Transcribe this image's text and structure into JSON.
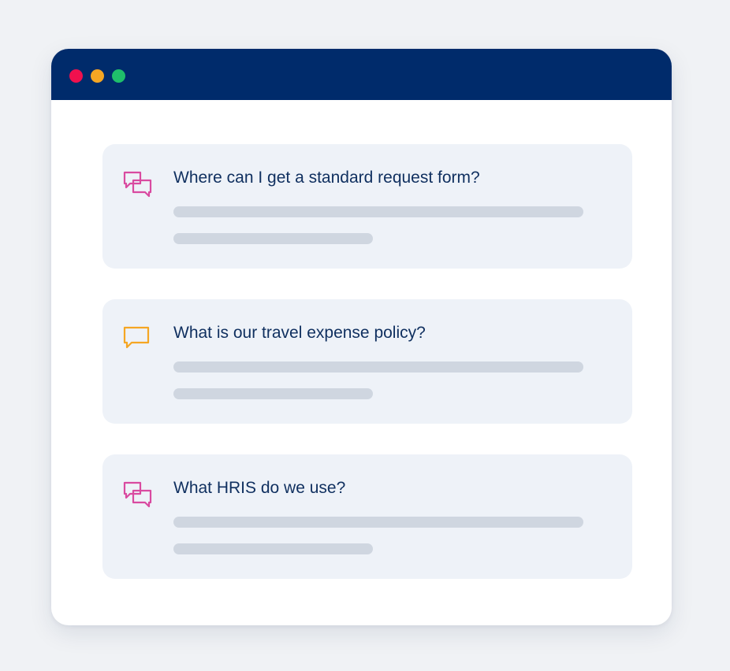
{
  "window": {
    "controls": [
      {
        "name": "close",
        "color": "#f0114e"
      },
      {
        "name": "minimize",
        "color": "#f5a623"
      },
      {
        "name": "maximize",
        "color": "#1fbf6b"
      }
    ]
  },
  "questions": [
    {
      "text": "Where can I get a standard request form?",
      "icon": "chat-bubbles-icon",
      "icon_color": "#d94aa0"
    },
    {
      "text": "What is our travel expense policy?",
      "icon": "chat-bubble-icon",
      "icon_color": "#f5a623"
    },
    {
      "text": "What HRIS do we use?",
      "icon": "chat-bubbles-icon",
      "icon_color": "#d94aa0"
    }
  ],
  "colors": {
    "titlebar": "#002b6b",
    "text": "#0f2f5f",
    "card_background": "#eef2f8",
    "placeholder_line": "#cfd6e0"
  }
}
